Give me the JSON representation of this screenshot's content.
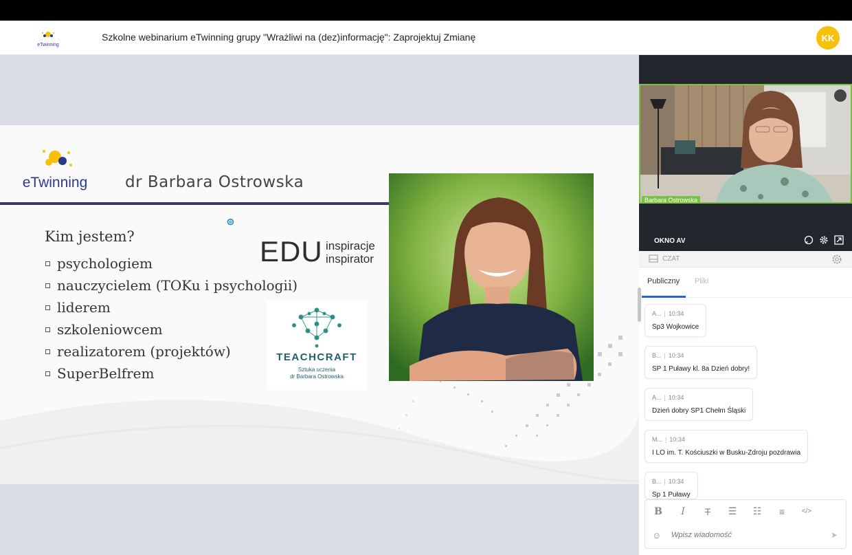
{
  "header": {
    "logo_text": "eTwinning",
    "title": "Szkolne webinarium eTwinning grupy \"Wrażliwi na (dez)informację\": Zaprojektuj Zmianę",
    "avatar_initials": "KK"
  },
  "slide": {
    "logo_text": "eTwinning",
    "presenter": "dr Barbara Ostrowska",
    "question": "Kim jestem?",
    "roles": [
      "psychologiem",
      "nauczycielem (TOKu i psychologii)",
      "liderem",
      "szkoleniowcem",
      "realizatorem (projektów)",
      "SuperBelfrem"
    ],
    "edu_main": "EDU",
    "edu_line1": "inspiracje",
    "edu_line2": "inspirator",
    "teachcraft_name": "TEACHCRAFT",
    "teachcraft_line1": "Sztuka uczenia",
    "teachcraft_line2": "dr Barbara Ostrowska"
  },
  "video": {
    "participant_name": "Barbara Ostrowska",
    "panel_label": "OKNO AV"
  },
  "chat": {
    "label": "CZAT",
    "tabs": [
      "Publiczny",
      "Pliki"
    ],
    "messages": [
      {
        "author": "A...",
        "time": "10:34",
        "text": "Sp3 Wojkowice"
      },
      {
        "author": "B...",
        "time": "10:34",
        "text": "SP 1 Puławy kl. 8a Dzień dobry!"
      },
      {
        "author": "A...",
        "time": "10:34",
        "text": "Dzień dobry SP1 Chełm Śląski"
      },
      {
        "author": "M...",
        "time": "10:34",
        "text": "I LO im. T. Kościuszki w Busku-Zdroju pozdrawia"
      },
      {
        "author": "B...",
        "time": "10:34",
        "text": "Sp 1 Puławy"
      }
    ],
    "composer_placeholder": "Wpisz wiadomość"
  },
  "colors": {
    "accent_green": "#7ac143",
    "avatar_yellow": "#f4c20d",
    "slide_rule": "#3b3a66"
  }
}
